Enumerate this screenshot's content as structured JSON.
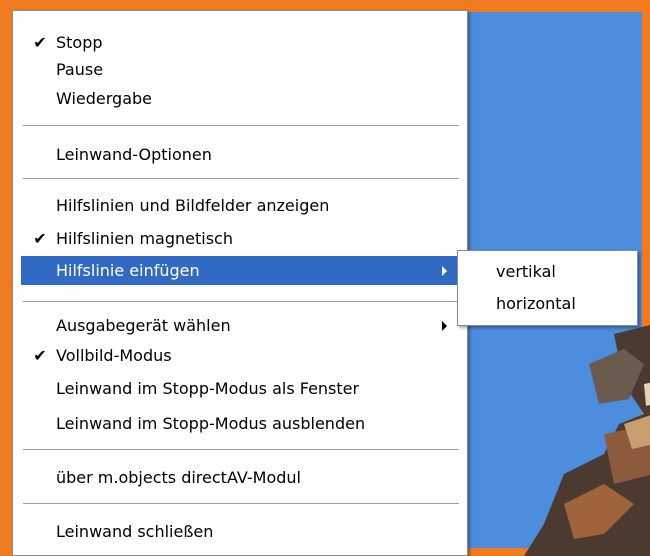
{
  "menu": {
    "items": [
      {
        "label": "Stopp",
        "checked": true
      },
      {
        "label": "Pause",
        "checked": false
      },
      {
        "label": "Wiedergabe",
        "checked": false
      },
      {
        "label": "Leinwand-Optionen",
        "checked": false
      },
      {
        "label": "Hilfslinien und Bildfelder anzeigen",
        "checked": false
      },
      {
        "label": "Hilfslinien magnetisch",
        "checked": true
      },
      {
        "label": "Hilfslinie einfügen",
        "checked": false,
        "highlighted": true,
        "has_submenu": true
      },
      {
        "label": "Ausgabegerät wählen",
        "checked": false,
        "has_submenu": true
      },
      {
        "label": "Vollbild-Modus",
        "checked": true
      },
      {
        "label": "Leinwand im Stopp-Modus als Fenster",
        "checked": false
      },
      {
        "label": "Leinwand im Stopp-Modus ausblenden",
        "checked": false
      },
      {
        "label": "über m.objects directAV-Modul",
        "checked": false
      },
      {
        "label": "Leinwand schließen",
        "checked": false
      }
    ],
    "check_glyph": "✔"
  },
  "submenu": {
    "items": [
      {
        "label": "vertikal"
      },
      {
        "label": "horizontal"
      }
    ]
  },
  "colors": {
    "frame": "#f07a1e",
    "canvas": "#4d8ddd",
    "highlight": "#316ac5"
  }
}
